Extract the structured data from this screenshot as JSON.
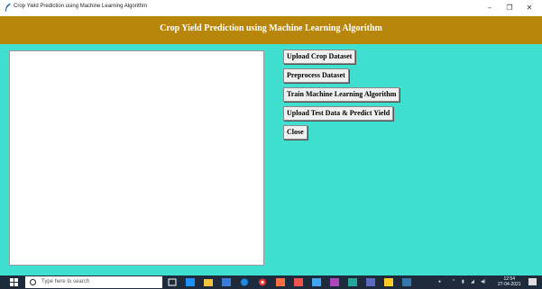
{
  "window": {
    "title": "Crop Yield Prediction using Machine Learning Algorithm",
    "minimize_glyph": "–",
    "maximize_glyph": "❐",
    "close_glyph": "✕"
  },
  "header": {
    "title": "Crop Yield Prediction using Machine Learning Algorithm"
  },
  "buttons": [
    {
      "label": "Upload Crop Dataset"
    },
    {
      "label": "Preprocess Dataset"
    },
    {
      "label": "Train Machine Learning Algorithm"
    },
    {
      "label": "Upload Test Data & Predict Yield"
    },
    {
      "label": "Close"
    }
  ],
  "output": {
    "text": ""
  },
  "taskbar": {
    "search_placeholder": "Type here to search",
    "clock_time": "12:54",
    "clock_date": "27-04-2021",
    "tray_icons": [
      "people-icon",
      "chevron-up-icon",
      "battery-icon",
      "network-icon",
      "volume-icon"
    ],
    "pinned_icons": [
      "task-view-icon",
      "edge-icon",
      "file-explorer-icon",
      "store-icon",
      "chrome-icon",
      "mail-icon",
      "settings-icon"
    ]
  },
  "colors": {
    "background": "#40e0d0",
    "header": "#b8860b",
    "taskbar": "#1d2b3c"
  }
}
